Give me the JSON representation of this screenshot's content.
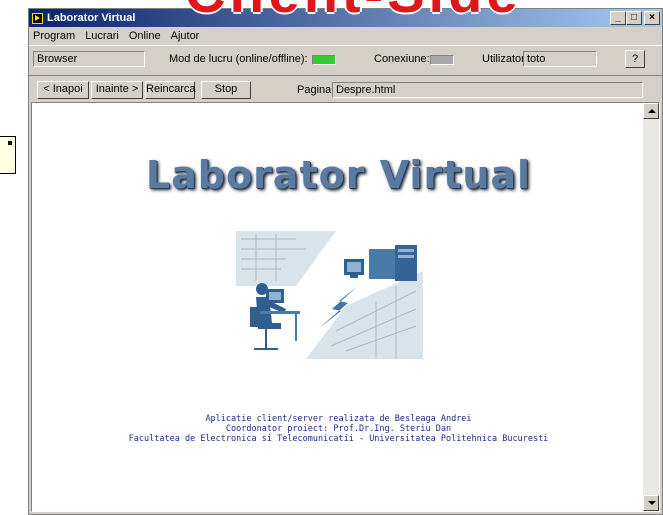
{
  "overlay": {
    "title": "Client-Side"
  },
  "window": {
    "title": "Laborator Virtual"
  },
  "menu": {
    "items": [
      "Program",
      "Lucrari",
      "Online",
      "Ajutor"
    ]
  },
  "status": {
    "mode_field": "Browser",
    "mode_label": "Mod de lucru (online/offline):",
    "mode_led_color": "#33cc33",
    "conn_label": "Conexiune:",
    "conn_led_color": "#a8a8a8",
    "user_label": "Utilizator:",
    "user_value": "toto",
    "help_label": "?"
  },
  "nav": {
    "back": "< Inapoi",
    "forward": "Inainte >",
    "reload": "Reincarca",
    "stop": "Stop",
    "page_label": "Pagina:",
    "page_value": "Despre.html"
  },
  "content": {
    "heading": "Laborator Virtual",
    "footer_line1": "Aplicatie client/server realizata de Besleaga Andrei",
    "footer_line2": "Coordonator proiect: Prof.Dr.Ing. Steriu Dan",
    "footer_line3": "Facultatea de Electronica si Telecomunicatii - Universitatea Politehnica Bucuresti"
  },
  "colors": {
    "titlebar_start": "#0a246a",
    "titlebar_end": "#a6caf0",
    "window_bg": "#d4d0c8",
    "overlay_red": "#e0161a",
    "footer_text": "#1f2a8a"
  }
}
